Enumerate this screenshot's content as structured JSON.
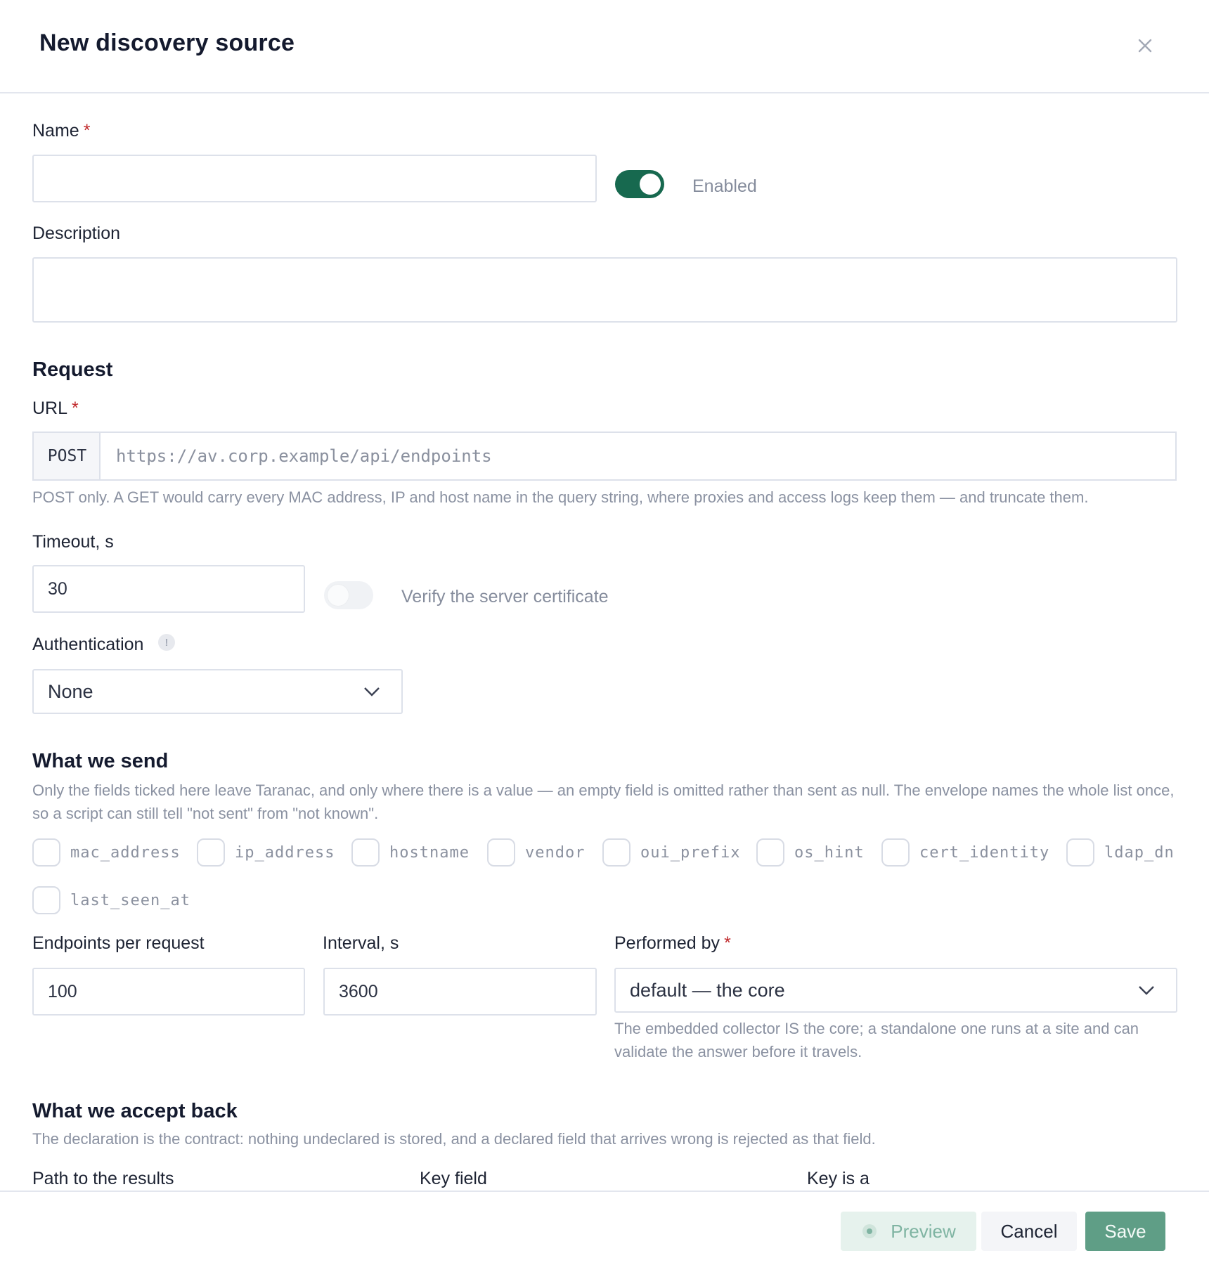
{
  "header": {
    "title": "New discovery source"
  },
  "name": {
    "label": "Name",
    "required_mark": "*",
    "value": ""
  },
  "enabled": {
    "label": "Enabled",
    "on": true
  },
  "description": {
    "label": "Description",
    "value": ""
  },
  "request": {
    "heading": "Request",
    "url_label": "URL",
    "required_mark": "*",
    "method": "POST",
    "url_placeholder": "https://av.corp.example/api/endpoints",
    "url_hint": "POST only. A GET would carry every MAC address, IP and host name in the query string, where proxies and access logs keep them — and truncate them.",
    "timeout_label": "Timeout, s",
    "timeout_value": "30",
    "verify_label": "Verify the server certificate",
    "verify_on": false,
    "auth_label": "Authentication",
    "auth_info_glyph": "!",
    "auth_value": "None"
  },
  "send": {
    "heading": "What we send",
    "hint": "Only the fields ticked here leave Taranac, and only where there is a value — an empty field is omitted rather than sent as null. The envelope names the whole list once, so a script can still tell \"not sent\" from \"not known\".",
    "fields": [
      {
        "name": "mac_address",
        "checked": true
      },
      {
        "name": "ip_address",
        "checked": true
      },
      {
        "name": "hostname",
        "checked": true
      },
      {
        "name": "vendor",
        "checked": false
      },
      {
        "name": "oui_prefix",
        "checked": false
      },
      {
        "name": "os_hint",
        "checked": false
      },
      {
        "name": "cert_identity",
        "checked": false
      },
      {
        "name": "ldap_dn",
        "checked": false
      },
      {
        "name": "last_seen_at",
        "checked": false
      }
    ],
    "per_request_label": "Endpoints per request",
    "per_request_value": "100",
    "interval_label": "Interval, s",
    "interval_value": "3600",
    "performed_label": "Performed by",
    "required_mark": "*",
    "performed_value": "default — the core",
    "performed_hint": "The embedded collector IS the core; a standalone one runs at a site and can validate the answer before it travels."
  },
  "accept": {
    "heading": "What we accept back",
    "hint": "The declaration is the contract: nothing undeclared is stored, and a declared field that arrives wrong is rejected as that field.",
    "path_label": "Path to the results",
    "key_field_label": "Key field",
    "key_is_label": "Key is a"
  },
  "footer": {
    "preview": "Preview",
    "cancel": "Cancel",
    "save": "Save"
  },
  "colors": {
    "accent": "#17694f",
    "required": "#c0292b",
    "save_bg": "#5f9e86",
    "preview_bg": "#e6f2ed"
  },
  "icons": {
    "close": "close-icon",
    "chevron": "chevron-down-icon",
    "check": "check-icon",
    "eye": "eye-icon",
    "info": "info-icon"
  }
}
